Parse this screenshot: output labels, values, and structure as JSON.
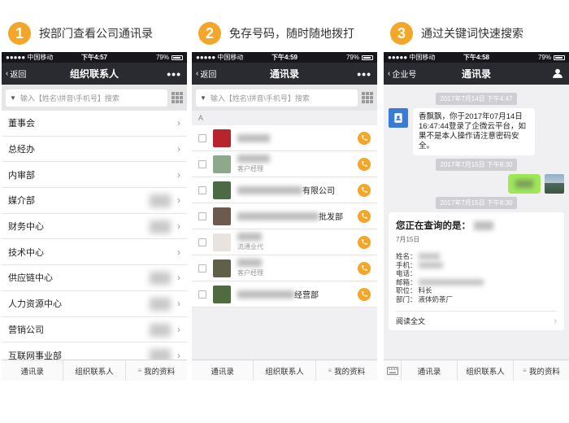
{
  "steps": [
    {
      "number": "1",
      "caption": "按部门查看公司通讯录"
    },
    {
      "number": "2",
      "caption": "免存号码，随时随地拨打"
    },
    {
      "number": "3",
      "caption": "通过关键词快速搜索"
    }
  ],
  "colors": {
    "accent": "#f4a62a",
    "navbar": "#2a2a31",
    "statusbar": "#16161b",
    "green_bubble": "#a0e75a",
    "app_icon": "#3a7bd5"
  },
  "screen1": {
    "status": {
      "carrier": "●●●●● 中国移动 ",
      "time": "下午4:57",
      "battery": "79%"
    },
    "nav": {
      "back": "返回",
      "title": "组织联系人"
    },
    "search_placeholder": "输入【姓名\\拼音\\手机号】搜索",
    "departments": [
      "董事会",
      "总经办",
      "内审部",
      "媒介部",
      "财务中心",
      "技术中心",
      "供应链中心",
      "人力资源中心",
      "营销公司",
      "互联网事业部"
    ],
    "tabs": [
      "通讯录",
      "组织联系人",
      "我的资料"
    ]
  },
  "screen2": {
    "status": {
      "carrier": "●●●●● 中国移动 ",
      "time": "下午4:59",
      "battery": "79%"
    },
    "nav": {
      "back": "返回",
      "title": "通讯录"
    },
    "search_placeholder": "输入【姓名\\拼音\\手机号】搜索",
    "section": "A",
    "contacts": [
      {
        "suffix": "",
        "subtitle": ""
      },
      {
        "suffix": "",
        "subtitle": "客户经理"
      },
      {
        "suffix": "有限公司",
        "subtitle": ""
      },
      {
        "suffix": "批发部",
        "subtitle": ""
      },
      {
        "suffix": "",
        "subtitle": "流通业代"
      },
      {
        "suffix": "",
        "subtitle": "客户经理"
      },
      {
        "suffix": "经营部",
        "subtitle": ""
      }
    ],
    "tabs": [
      "通讯录",
      "组织联系人",
      "我的资料"
    ]
  },
  "screen3": {
    "status": {
      "carrier": "●●●●● 中国移动 ",
      "time": "下午4:58",
      "battery": "79%"
    },
    "nav": {
      "back": "企业号",
      "title": "通讯录"
    },
    "ts1": "2017年7月14日 下午4:47",
    "message": "香飘飘，你于2017年07月14日 16:47:44登录了企微云平台，如果不是本人操作请注意密码安全。",
    "ts2": "2017年7月15日 下午8:30",
    "ts3": "2017年7月15日 下午8:30",
    "card": {
      "title": "您正在查询的是：",
      "date": "7月15日",
      "fields": [
        {
          "label": "姓名：",
          "value": ""
        },
        {
          "label": "手机：",
          "value": ""
        },
        {
          "label": "电话：",
          "value": ""
        },
        {
          "label": "邮箱：",
          "value": ""
        },
        {
          "label": "职位：",
          "value": "科长"
        },
        {
          "label": "部门：",
          "value": "液体奶茶厂"
        }
      ],
      "read_more": "阅读全文"
    },
    "tabs": [
      "通讯录",
      "组织联系人",
      "我的资料"
    ]
  }
}
